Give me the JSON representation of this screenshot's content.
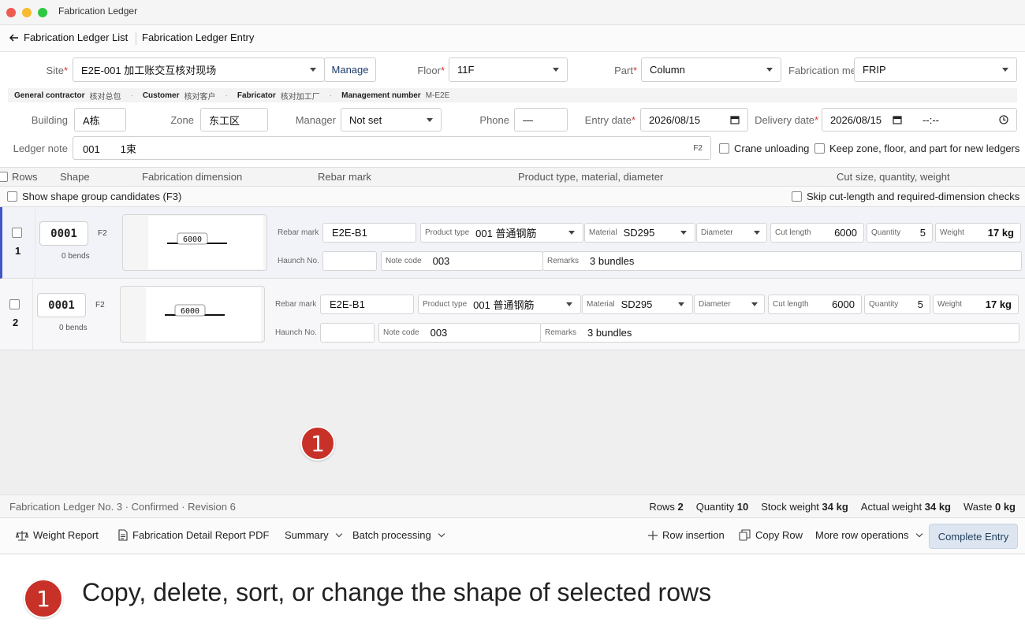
{
  "window": {
    "title": "Fabrication Ledger",
    "dots": [
      "#ee5b51",
      "#f6bb2f",
      "#2fc841"
    ]
  },
  "nav": {
    "back_label": "Fabrication Ledger List",
    "title": "Fabrication Ledger Entry"
  },
  "form": {
    "site": {
      "label": "Site",
      "value": "E2E-001 加工账交互核对现场",
      "manage": "Manage"
    },
    "floor": {
      "label": "Floor",
      "value": "11F"
    },
    "part": {
      "label": "Part",
      "value": "Column"
    },
    "fab_method": {
      "label": "Fabrication me",
      "value": "FRIP"
    },
    "building": {
      "label": "Building",
      "value": "A栋"
    },
    "zone": {
      "label": "Zone",
      "value": "东工区"
    },
    "manager": {
      "label": "Manager",
      "value": "Not set"
    },
    "phone": {
      "label": "Phone",
      "value": "—"
    },
    "entry_date": {
      "label": "Entry date",
      "value": "2026/08/15"
    },
    "delivery_date": {
      "label": "Delivery date",
      "value": "2026/08/15",
      "time": "--:--"
    },
    "ledger_note": {
      "label": "Ledger note",
      "value": "001　　1束",
      "shortcut": "F2"
    },
    "crane_unloading": "Crane unloading",
    "keep_zone": "Keep zone, floor, and part for new ledgers"
  },
  "info": {
    "gc_k": "General contractor",
    "gc_v": "核对总包",
    "cust_k": "Customer",
    "cust_v": "核对客户",
    "fab_k": "Fabricator",
    "fab_v": "核对加工厂",
    "mgmt_k": "Management number",
    "mgmt_v": "M-E2E"
  },
  "table": {
    "headers": {
      "rows": "Rows",
      "shape": "Shape",
      "dimension": "Fabrication dimension",
      "mark": "Rebar mark",
      "product": "Product type, material, diameter",
      "cut": "Cut size, quantity, weight"
    },
    "show_candidates": "Show shape group candidates (F3)",
    "skip_checks": "Skip cut-length and required-dimension checks",
    "labels": {
      "rebar_mark": "Rebar mark",
      "product_type": "Product type",
      "material": "Material",
      "diameter": "Diameter",
      "cut_length": "Cut length",
      "quantity": "Quantity",
      "weight": "Weight",
      "haunch": "Haunch No.",
      "note_code": "Note code",
      "remarks": "Remarks"
    },
    "rows": [
      {
        "index": "1",
        "code": "0001",
        "shortcut": "F2",
        "bends": "0 bends",
        "dim": "6000",
        "rebar_mark": "E2E-B1",
        "product_type": "001 普通钢筋",
        "material": "SD295",
        "diameter": "",
        "cut_length": "6000",
        "quantity": "5",
        "weight": "17 kg",
        "haunch": "",
        "note_code": "003",
        "remarks": "3 bundles"
      },
      {
        "index": "2",
        "code": "0001",
        "shortcut": "F2",
        "bends": "0 bends",
        "dim": "6000",
        "rebar_mark": "E2E-B1",
        "product_type": "001 普通钢筋",
        "material": "SD295",
        "diameter": "",
        "cut_length": "6000",
        "quantity": "5",
        "weight": "17 kg",
        "haunch": "",
        "note_code": "003",
        "remarks": "3 bundles"
      }
    ]
  },
  "status": {
    "ledger_info": "Fabrication Ledger No. 3 · Confirmed · Revision 6",
    "rows_k": "Rows",
    "rows_v": "2",
    "qty_k": "Quantity",
    "qty_v": "10",
    "stock_k": "Stock weight",
    "stock_v": "34 kg",
    "actual_k": "Actual weight",
    "actual_v": "34 kg",
    "waste_k": "Waste",
    "waste_v": "0 kg"
  },
  "toolbar": {
    "weight_report": "Weight Report",
    "detail_pdf": "Fabrication Detail Report PDF",
    "summary": "Summary",
    "batch": "Batch processing",
    "row_insert": "Row insertion",
    "copy_row": "Copy Row",
    "more_ops": "More row operations",
    "complete": "Complete Entry"
  },
  "annotation": {
    "marker": "1",
    "caption": "Copy, delete, sort, or change the shape of selected rows",
    "color": "#c73128"
  }
}
